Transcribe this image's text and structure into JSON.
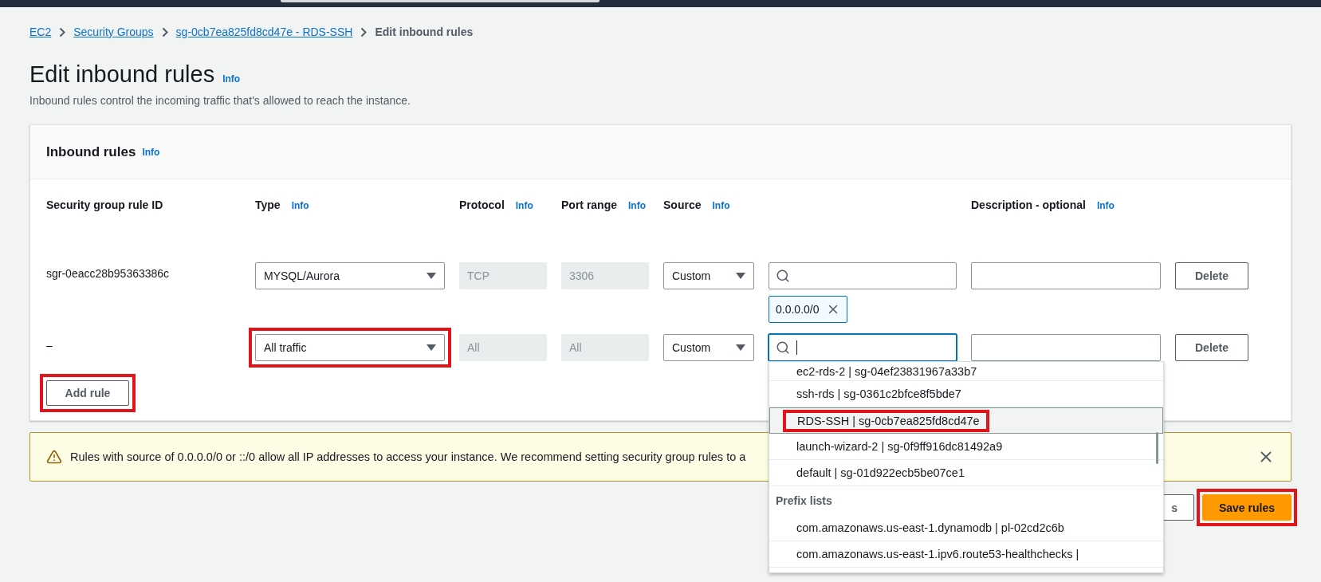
{
  "breadcrumbs": [
    {
      "label": "EC2",
      "link": true
    },
    {
      "label": "Security Groups",
      "link": true
    },
    {
      "label": "sg-0cb7ea825fd8cd47e - RDS-SSH",
      "link": true
    },
    {
      "label": "Edit inbound rules",
      "link": false
    }
  ],
  "page": {
    "title": "Edit inbound rules",
    "info": "Info",
    "description": "Inbound rules control the incoming traffic that's allowed to reach the instance."
  },
  "panel": {
    "title": "Inbound rules",
    "info": "Info",
    "columns": [
      {
        "label": "Security group rule ID"
      },
      {
        "label": "Type",
        "info": "Info"
      },
      {
        "label": "Protocol",
        "info": "Info"
      },
      {
        "label": "Port range",
        "info": "Info"
      },
      {
        "label": "Source",
        "info": "Info"
      },
      {
        "label": "Description - optional",
        "info": "Info"
      }
    ],
    "rules": [
      {
        "id": "sgr-0eacc28b95363386c",
        "type": "MYSQL/Aurora",
        "type_highlighted": false,
        "protocol": "TCP",
        "port_range": "3306",
        "source": "Custom",
        "focused": false,
        "tags": [
          "0.0.0.0/0"
        ],
        "delete": "Delete"
      },
      {
        "id": "–",
        "type": "All traffic",
        "type_highlighted": true,
        "protocol": "All",
        "port_range": "All",
        "source": "Custom",
        "focused": true,
        "delete": "Delete"
      }
    ],
    "add_button": {
      "label": "Add rule",
      "highlighted": true
    }
  },
  "warning": {
    "text": "Rules with source of 0.0.0.0/0 or ::/0 allow all IP addresses to access your instance. We recommend setting security group rules to a"
  },
  "footer_buttons": [
    {
      "label": "s",
      "kind": "secondary",
      "highlighted": false
    },
    {
      "label": "Save rules",
      "kind": "primary",
      "highlighted": true
    }
  ],
  "source_menu": {
    "items": [
      {
        "kind": "option",
        "label": "ec2-rds-2 | sg-04ef23831967a33b7",
        "hovered": false,
        "highlighted": false
      },
      {
        "kind": "option",
        "label": "ssh-rds | sg-0361c2bfce8f5bde7",
        "hovered": false,
        "highlighted": false
      },
      {
        "kind": "option",
        "label": "RDS-SSH | sg-0cb7ea825fd8cd47e",
        "hovered": true,
        "highlighted": true
      },
      {
        "kind": "option",
        "label": "launch-wizard-2 | sg-0f9ff916dc81492a9",
        "hovered": false,
        "highlighted": false
      },
      {
        "kind": "option",
        "label": "default | sg-01d922ecb5be07ce1",
        "hovered": false,
        "highlighted": false
      },
      {
        "kind": "group",
        "label": "Prefix lists"
      },
      {
        "kind": "option",
        "label": "com.amazonaws.us-east-1.dynamodb | pl-02cd2c6b",
        "hovered": false,
        "highlighted": false
      },
      {
        "kind": "option",
        "label": "com.amazonaws.us-east-1.ipv6.route53-healthchecks |",
        "hovered": false,
        "highlighted": false
      }
    ]
  }
}
